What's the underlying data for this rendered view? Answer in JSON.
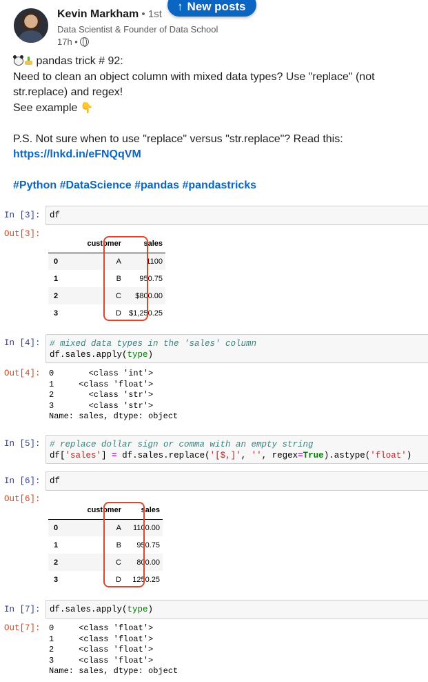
{
  "post": {
    "author_name": "Kevin Markham",
    "degree": " • 1st",
    "headline": "Data Scientist & Founder of Data School",
    "time": "17h •",
    "new_posts_label": "New posts",
    "line1": " pandas trick # 92:",
    "line2": "Need to clean an object column with mixed data types? Use \"replace\" (not str.replace) and regex!",
    "line3": "See example ",
    "ps_text": "P.S. Not sure when to use \"replace\" versus \"str.replace\"? Read this: ",
    "ps_link": "https://lnkd.in/eFNQqVM",
    "hashtags": [
      "#Python",
      "#DataScience",
      "#pandas",
      "#pandastricks"
    ],
    "icons": [
      "panda-icon",
      "bamboo-icon",
      "point-down-icon",
      "globe-icon",
      "arrow-up-icon"
    ]
  },
  "notebook": {
    "cell3": {
      "in_prompt": "In [3]:",
      "code": "df",
      "out_prompt": "Out[3]:"
    },
    "df1": {
      "columns": [
        "customer",
        "sales"
      ],
      "rows": [
        {
          "index": "0",
          "customer": "A",
          "sales": "1100"
        },
        {
          "index": "1",
          "customer": "B",
          "sales": "950.75"
        },
        {
          "index": "2",
          "customer": "C",
          "sales": "$800.00"
        },
        {
          "index": "3",
          "customer": "D",
          "sales": "$1,250.25"
        }
      ]
    },
    "cell4": {
      "in_prompt": "In [4]:",
      "comment": "# mixed data types in the 'sales' column",
      "code_a": "df.sales.apply(",
      "code_builtin": "type",
      "code_b": ")",
      "out_prompt": "Out[4]:",
      "output": "0       <class 'int'>\n1     <class 'float'>\n2       <class 'str'>\n3       <class 'str'>\nName: sales, dtype: object"
    },
    "cell5": {
      "in_prompt": "In [5]:",
      "comment": "# replace dollar sign or comma with an empty string",
      "p1": "df[",
      "s1": "'sales'",
      "p2": "] ",
      "op": "=",
      "p3": " df.sales.replace(",
      "s2": "'[$,]'",
      "p4": ", ",
      "s3": "''",
      "p5": ", regex",
      "op2": "=",
      "kw": "True",
      "p6": ").astype(",
      "s4": "'float'",
      "p7": ")"
    },
    "cell6": {
      "in_prompt": "In [6]:",
      "code": "df",
      "out_prompt": "Out[6]:"
    },
    "df2": {
      "columns": [
        "customer",
        "sales"
      ],
      "rows": [
        {
          "index": "0",
          "customer": "A",
          "sales": "1100.00"
        },
        {
          "index": "1",
          "customer": "B",
          "sales": "950.75"
        },
        {
          "index": "2",
          "customer": "C",
          "sales": "800.00"
        },
        {
          "index": "3",
          "customer": "D",
          "sales": "1250.25"
        }
      ]
    },
    "cell7": {
      "in_prompt": "In [7]:",
      "code_a": "df.sales.apply(",
      "code_builtin": "type",
      "code_b": ")",
      "out_prompt": "Out[7]:",
      "output": "0     <class 'float'>\n1     <class 'float'>\n2     <class 'float'>\n3     <class 'float'>\nName: sales, dtype: object"
    },
    "highlight_color": "#d9462b"
  }
}
